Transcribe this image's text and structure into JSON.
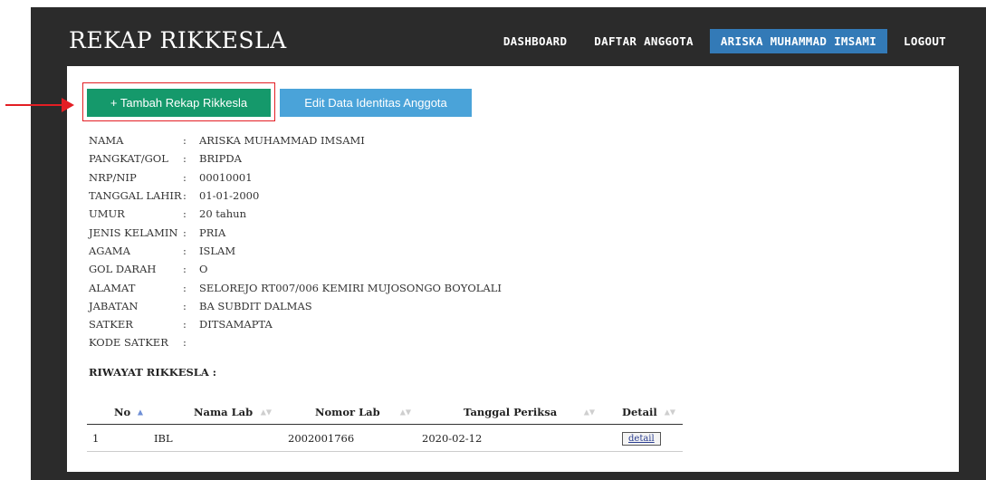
{
  "header": {
    "title": "REKAP RIKKESLA",
    "nav": [
      {
        "label": "DASHBOARD"
      },
      {
        "label": "DAFTAR ANGGOTA"
      },
      {
        "label": "ARISKA MUHAMMAD IMSAMI"
      },
      {
        "label": "LOGOUT"
      }
    ],
    "active_nav": "ARISKA MUHAMMAD IMSAMI"
  },
  "actions": {
    "add_label": "+ Tambah Rekap Rikkesla",
    "edit_label": "Edit Data Identitas Anggota"
  },
  "profile": [
    {
      "label": "NAMA",
      "value": "ARISKA MUHAMMAD IMSAMI"
    },
    {
      "label": "PANGKAT/GOL",
      "value": "BRIPDA"
    },
    {
      "label": "NRP/NIP",
      "value": "00010001"
    },
    {
      "label": "TANGGAL LAHIR",
      "value": "01-01-2000"
    },
    {
      "label": "UMUR",
      "value": "20 tahun"
    },
    {
      "label": "JENIS KELAMIN",
      "value": "PRIA"
    },
    {
      "label": "AGAMA",
      "value": "ISLAM"
    },
    {
      "label": "GOL DARAH",
      "value": "O"
    },
    {
      "label": "ALAMAT",
      "value": "SELOREJO RT007/006 KEMIRI MUJOSONGO BOYOLALI"
    },
    {
      "label": "JABATAN",
      "value": "BA SUBDIT DALMAS"
    },
    {
      "label": "SATKER",
      "value": "DITSAMAPTA"
    },
    {
      "label": "KODE SATKER",
      "value": ""
    }
  ],
  "colon": ":",
  "history": {
    "title": "RIWAYAT RIKKESLA :",
    "columns": [
      "No",
      "Nama Lab",
      "Nomor Lab",
      "Tanggal Periksa",
      "Detail"
    ],
    "rows": [
      {
        "no": "1",
        "nama_lab": "IBL",
        "nomor_lab": "2002001766",
        "tanggal": "2020-02-12",
        "detail": "detail"
      }
    ]
  },
  "colors": {
    "header_bg": "#2b2b2b",
    "active_nav": "#337ab7",
    "add_button": "#15996b",
    "edit_button": "#4aa3d9",
    "annotation": "#e31e24"
  },
  "icons": {
    "sort_asc": "▲",
    "sort_both": "▲▼",
    "annotation": "arrow-right"
  }
}
